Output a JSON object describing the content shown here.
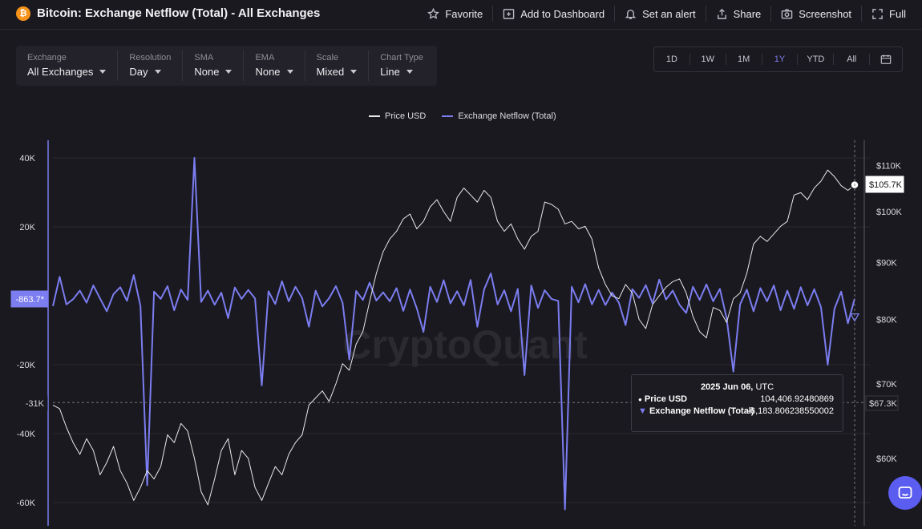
{
  "header": {
    "title": "Bitcoin: Exchange Netflow (Total) - All Exchanges",
    "brand_glyph": "₿",
    "actions": [
      {
        "label": "Favorite",
        "icon": "star-icon"
      },
      {
        "label": "Add to Dashboard",
        "icon": "dashboard-add-icon"
      },
      {
        "label": "Set an alert",
        "icon": "bell-icon"
      },
      {
        "label": "Share",
        "icon": "share-icon"
      },
      {
        "label": "Screenshot",
        "icon": "camera-icon"
      },
      {
        "label": "Full",
        "icon": "fullscreen-icon"
      }
    ]
  },
  "filters": [
    {
      "label": "Exchange",
      "value": "All Exchanges"
    },
    {
      "label": "Resolution",
      "value": "Day"
    },
    {
      "label": "SMA",
      "value": "None"
    },
    {
      "label": "EMA",
      "value": "None"
    },
    {
      "label": "Scale",
      "value": "Mixed"
    },
    {
      "label": "Chart Type",
      "value": "Line"
    }
  ],
  "ranges": [
    "1D",
    "1W",
    "1M",
    "1Y",
    "YTD",
    "All"
  ],
  "active_range": "1Y",
  "tooltip": {
    "date": "2025 Jun 06,",
    "tz": "UTC",
    "rows": [
      {
        "marker": "●",
        "label": "Price USD",
        "value": "104,406.92480869"
      },
      {
        "marker": "▼",
        "label": "Exchange Netflow (Total)",
        "value": "-6,183.806238550002"
      }
    ]
  },
  "watermark": "CryptoQuant",
  "chart_data": {
    "type": "line",
    "legend_position": "top-center",
    "grid": true,
    "series": [
      {
        "name": "Price USD",
        "axis": "right",
        "color": "#e8e8e8",
        "values": [
          67000,
          66500,
          64000,
          62000,
          60500,
          62500,
          61000,
          58000,
          59500,
          61500,
          58500,
          57000,
          55000,
          56500,
          58500,
          57500,
          59000,
          63000,
          62000,
          64500,
          63500,
          60000,
          56000,
          54500,
          57500,
          61000,
          62500,
          58000,
          61000,
          60000,
          56500,
          55000,
          57000,
          59000,
          58000,
          60500,
          62000,
          63000,
          67000,
          68000,
          69000,
          67500,
          70000,
          73000,
          72000,
          76000,
          78000,
          83000,
          88000,
          92000,
          94500,
          96000,
          98500,
          99500,
          96500,
          98000,
          101000,
          102500,
          100000,
          98000,
          103000,
          105000,
          103500,
          102000,
          104500,
          103000,
          98000,
          96000,
          97500,
          94500,
          92500,
          95000,
          96000,
          102000,
          101500,
          100500,
          97500,
          98000,
          96500,
          97000,
          94500,
          89000,
          86000,
          84000,
          83500,
          86000,
          84500,
          80000,
          78500,
          82500,
          84000,
          85500,
          86500,
          87000,
          84500,
          80500,
          78000,
          77000,
          82000,
          81500,
          79500,
          83500,
          84500,
          88000,
          93500,
          95000,
          94000,
          95500,
          97000,
          98000,
          103500,
          104000,
          102500,
          105000,
          106500,
          109000,
          107500,
          105500,
          104500,
          105700
        ]
      },
      {
        "name": "Exchange Netflow (Total)",
        "axis": "left",
        "color": "#7b7df0",
        "values": [
          -3000,
          5500,
          -2500,
          -1000,
          1500,
          -2000,
          3000,
          -800,
          -4500,
          500,
          2500,
          -1500,
          6000,
          -3000,
          -55000,
          1200,
          -900,
          2800,
          -4200,
          1800,
          -1200,
          40000,
          -1800,
          1500,
          -2600,
          900,
          -6500,
          2400,
          -900,
          1700,
          -800,
          -26000,
          1300,
          -2400,
          4200,
          -1600,
          2600,
          -700,
          -9000,
          1500,
          -3100,
          -700,
          2800,
          -2000,
          -18500,
          1400,
          -1200,
          3800,
          -1400,
          1000,
          -1600,
          2200,
          -4400,
          1800,
          -3600,
          -10500,
          2600,
          -1800,
          4500,
          -2200,
          1300,
          -2800,
          4600,
          -9000,
          1800,
          6500,
          -2500,
          1600,
          -4500,
          2000,
          -23000,
          3000,
          -3500,
          1600,
          -900,
          -1500,
          -62000,
          2600,
          -1900,
          3400,
          -2500,
          1700,
          -2700,
          900,
          -2000,
          -8500,
          1900,
          -600,
          3100,
          -2200,
          4700,
          -1100,
          1500,
          -2600,
          -5000,
          2600,
          -1200,
          3300,
          -1600,
          2000,
          -6500,
          -22000,
          -2500,
          1800,
          -4500,
          2200,
          -1600,
          3000,
          -4200,
          1500,
          -3800,
          2500,
          -2800,
          1900,
          -3300,
          -20000,
          -3800,
          1200,
          -8000,
          -863.7
        ]
      }
    ],
    "left_axis": {
      "ticks": [
        40000,
        20000,
        -20000,
        -40000,
        -60000
      ],
      "tick_labels": [
        "40K",
        "20K",
        "-20K",
        "-40K",
        "-60K"
      ],
      "ylim": [
        -62000,
        40000
      ]
    },
    "right_axis": {
      "scale": "log",
      "ticks": [
        110000,
        100000,
        90000,
        80000,
        70000,
        60000
      ],
      "tick_labels": [
        "$110K",
        "$100K",
        "$90K",
        "$80K",
        "$70K",
        "$60K"
      ],
      "ylim": [
        53000,
        115000
      ]
    },
    "crosshair": {
      "left_value": -31000,
      "left_label": "-31K",
      "right_label": "$67.3K"
    },
    "current_values": {
      "netflow_label": "-863.7*",
      "price_label": "$105.7K"
    }
  }
}
